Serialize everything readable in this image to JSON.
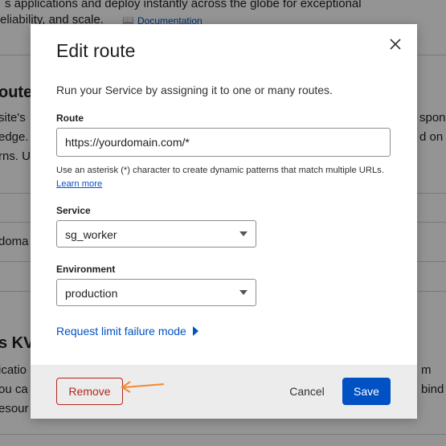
{
  "background": {
    "line1": "s applications and deploy instantly across the globe for exceptional",
    "line2": "eliability, and scale.",
    "docs_link": "Documentation",
    "heading_routes": "outes",
    "para_a1": "site's",
    "para_a2": "edge.",
    "para_a3": "rns. U",
    "right_a1": "spons",
    "right_a2": "d on",
    "row_domain": "doma",
    "heading_kv": "s KV",
    "para_b1": "icatio",
    "para_b2": "ou ca",
    "para_b3": "esour",
    "right_b1": "m",
    "right_b2": "bind"
  },
  "modal": {
    "title": "Edit route",
    "description": "Run your Service by assigning it to one or many routes.",
    "route": {
      "label": "Route",
      "value": "https://yourdomain.com/*",
      "help": "Use an asterisk (*) character to create dynamic patterns that match multiple URLs.",
      "help_link": "Learn more"
    },
    "service": {
      "label": "Service",
      "selected": "sg_worker"
    },
    "environment": {
      "label": "Environment",
      "selected": "production"
    },
    "request_limit": "Request limit failure mode",
    "footer": {
      "remove": "Remove",
      "cancel": "Cancel",
      "save": "Save"
    }
  },
  "colors": {
    "primary": "#0051c3",
    "danger": "#b3261e",
    "annotation_arrow": "#f28a2e",
    "footer_bg": "#ececec"
  },
  "icons": {
    "close": "close-icon",
    "docs": "book-icon",
    "select_caret": "caret-down-icon",
    "expander_caret": "caret-right-icon",
    "annotation": "arrow-left-icon"
  }
}
